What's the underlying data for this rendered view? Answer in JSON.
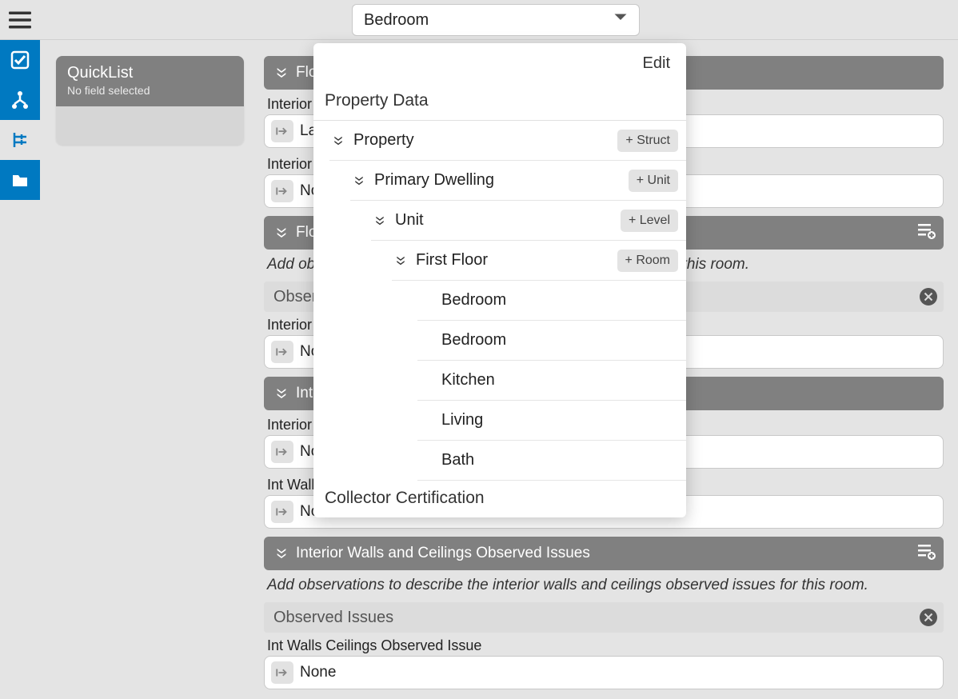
{
  "topbar": {
    "selector_value": "Bedroom"
  },
  "quicklist": {
    "title": "QuickList",
    "subtitle": "No field selected"
  },
  "main": {
    "sections": [
      {
        "title": "Flooring Details",
        "type": "bar"
      },
      {
        "label": "Interior Flooring Type",
        "value": "Laminate",
        "type": "field"
      },
      {
        "label": "Interior Flooring Condition",
        "value": "None",
        "type": "field"
      },
      {
        "title": "Flooring Observed Issues",
        "type": "bar",
        "add": true
      },
      {
        "note": "Add observations to describe the flooring observed issues for this room.",
        "type": "note"
      },
      {
        "title": "Observed Issues",
        "type": "sub",
        "close": true
      },
      {
        "label": "Interior Flooring Observed Issue",
        "value": "None",
        "type": "field"
      },
      {
        "title": "Interior Walls and Ceilings",
        "type": "bar"
      },
      {
        "label": "Interior Wall Ceiling Condition",
        "value": "None",
        "type": "field"
      },
      {
        "label": "Int Walls Ceilings Material",
        "value": "None",
        "type": "field"
      },
      {
        "title": "Interior Walls and Ceilings Observed Issues",
        "type": "bar",
        "add": true
      },
      {
        "note": "Add observations to describe the interior walls and ceilings observed issues for this room.",
        "type": "note"
      },
      {
        "title": "Observed Issues",
        "type": "sub",
        "close": true
      },
      {
        "label": "Int Walls Ceilings Observed Issue",
        "value": "None",
        "type": "field"
      }
    ]
  },
  "popover": {
    "edit": "Edit",
    "section1": "Property Data",
    "tree": [
      {
        "indent": 20,
        "label": "Property",
        "chev": true,
        "btn": "+ Struct"
      },
      {
        "indent": 46,
        "label": "Primary Dwelling",
        "chev": true,
        "btn": "+ Unit"
      },
      {
        "indent": 72,
        "label": "Unit",
        "chev": true,
        "btn": "+ Level"
      },
      {
        "indent": 98,
        "label": "First Floor",
        "chev": true,
        "btn": "+ Room"
      },
      {
        "indent": 130,
        "label": "Bedroom",
        "chev": false
      },
      {
        "indent": 130,
        "label": "Bedroom",
        "chev": false
      },
      {
        "indent": 130,
        "label": "Kitchen",
        "chev": false
      },
      {
        "indent": 130,
        "label": "Living",
        "chev": false
      },
      {
        "indent": 130,
        "label": "Bath",
        "chev": false
      }
    ],
    "section2": "Collector Certification"
  }
}
